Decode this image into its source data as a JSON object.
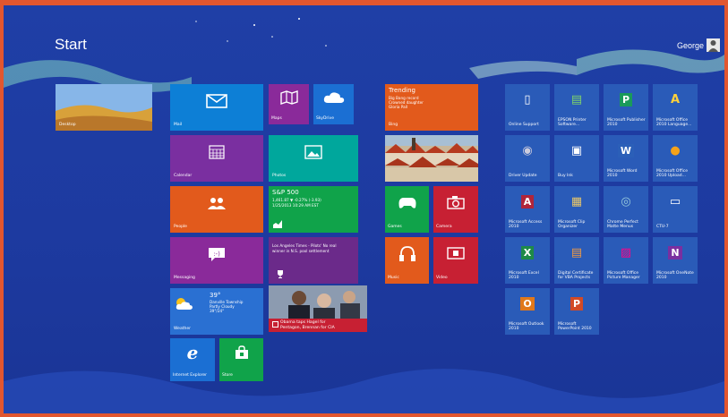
{
  "start": {
    "title": "Start"
  },
  "user": {
    "name": "George"
  },
  "colors": {
    "background": "#1f3fa6",
    "frame": "#e2562f",
    "blue_tile": "#1b6fd3",
    "purple_tile": "#7a2fa0",
    "orange_tile": "#e25a1c",
    "green_tile": "#10a34a",
    "dark_blue_tile": "#2a5bb8",
    "red_tile": "#d3233a",
    "desktop_tile": "#3b6ec8"
  },
  "tiles": {
    "desktop": {
      "label": "Desktop"
    },
    "mail": {
      "label": "Mail",
      "icon": "mail-icon"
    },
    "maps": {
      "label": "Maps",
      "icon": "map-icon"
    },
    "skydrive": {
      "label": "SkyDrive",
      "icon": "cloud-icon"
    },
    "calendar": {
      "label": "Calendar",
      "icon": "calendar-icon"
    },
    "photos": {
      "label": "Photos",
      "icon": "photo-icon"
    },
    "people": {
      "label": "People",
      "icon": "people-icon"
    },
    "finance": {
      "title": "S&P 500",
      "line1": "1,461.87 ▼ -0.27% (-3.93)",
      "line2": "1/25/2013 10:29 AM EST",
      "icon": "chart-icon"
    },
    "messaging": {
      "label": "Messaging",
      "icon": "chat-icon"
    },
    "sports": {
      "line1": "Los Angeles Times - Pilots' No real",
      "line2": "winner in N.S. pool settlement",
      "icon": "trophy-icon"
    },
    "weather": {
      "temp": "39°",
      "line1": "Danville Township",
      "line2": "Partly Cloudy",
      "line3": "39°/24°",
      "label": "Weather",
      "icon": "partly-cloudy-icon"
    },
    "news": {
      "headline1": "Obama taps Hagel for",
      "headline2": "Pentagon, Brennan for CIA",
      "icon": "news-icon"
    },
    "ie": {
      "label": "Internet Explorer",
      "icon": "ie-icon"
    },
    "store": {
      "label": "Store",
      "icon": "store-icon"
    },
    "bing": {
      "title": "Trending",
      "line1": "Big Bang record",
      "line2": "Crowned daughter",
      "line3": "Gloria Pall",
      "label": "Bing"
    },
    "travel": {
      "label": "Travel"
    },
    "games": {
      "label": "Games",
      "icon": "gamepad-icon"
    },
    "camera": {
      "label": "Camera",
      "icon": "camera-icon"
    },
    "music": {
      "label": "Music",
      "icon": "headphones-icon"
    },
    "video": {
      "label": "Video",
      "icon": "video-icon"
    }
  },
  "apps": [
    {
      "label": "Online Support",
      "icon": "document-icon",
      "color": "#2a5bb8"
    },
    {
      "label": "EPSON Printer Software...",
      "icon": "printer-icon",
      "color": "#2a5bb8"
    },
    {
      "label": "Microsoft Publisher 2010",
      "icon": "publisher-icon",
      "color": "#2a5bb8"
    },
    {
      "label": "Microsoft Office 2010 Language...",
      "icon": "language-icon",
      "color": "#2a5bb8"
    },
    {
      "label": "Driver Update",
      "icon": "satellite-icon",
      "color": "#2a5bb8"
    },
    {
      "label": "Buy Ink",
      "icon": "ink-icon",
      "color": "#2a5bb8"
    },
    {
      "label": "Microsoft Word 2010",
      "icon": "word-icon",
      "color": "#2a5bb8"
    },
    {
      "label": "Microsoft Office 2010 Upload...",
      "icon": "upload-icon",
      "color": "#2a5bb8"
    },
    {
      "label": "Microsoft Access 2010",
      "icon": "access-icon",
      "color": "#2a5bb8"
    },
    {
      "label": "Microsoft Clip Organizer",
      "icon": "clip-icon",
      "color": "#2a5bb8"
    },
    {
      "label": "Chrome Perfect Matte Menus",
      "icon": "globe-icon",
      "color": "#2a5bb8"
    },
    {
      "label": "CTU-7",
      "icon": "window-icon",
      "color": "#2a5bb8"
    },
    {
      "label": "Microsoft Excel 2010",
      "icon": "excel-icon",
      "color": "#2a5bb8"
    },
    {
      "label": "Digital Certificate for VBA Projects",
      "icon": "certificate-icon",
      "color": "#2a5bb8"
    },
    {
      "label": "Microsoft Office Picture Manager",
      "icon": "picture-icon",
      "color": "#2a5bb8"
    },
    {
      "label": "Microsoft OneNote 2010",
      "icon": "onenote-icon",
      "color": "#2a5bb8"
    },
    {
      "label": "Microsoft Outlook 2010",
      "icon": "outlook-icon",
      "color": "#2a5bb8"
    },
    {
      "label": "Microsoft PowerPoint 2010",
      "icon": "powerpoint-icon",
      "color": "#2a5bb8"
    }
  ]
}
